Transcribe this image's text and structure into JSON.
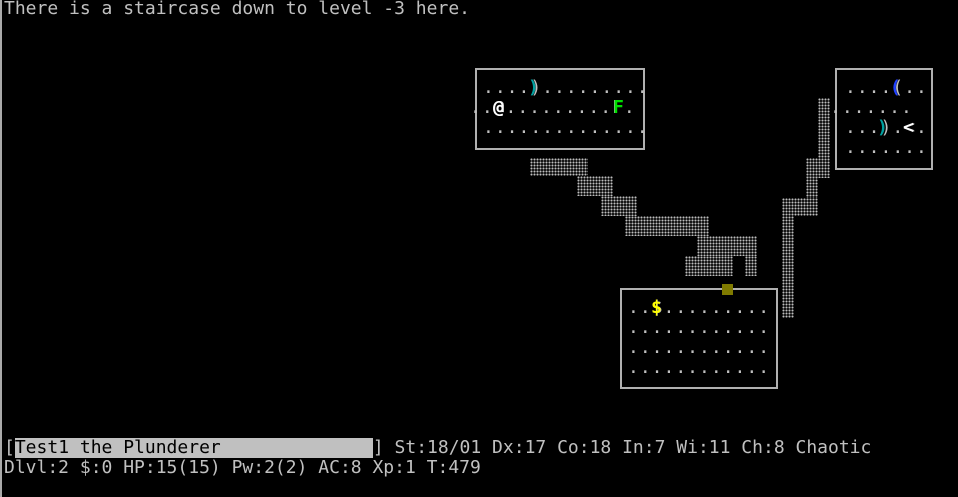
{
  "message": "There is a staircase down to level -3 here.",
  "map": {
    "room1": {
      "row1": "....).........",
      "row2": "..@.........F.",
      "row3": "..............",
      "player": "@",
      "weapon": ")",
      "lichen": "F"
    },
    "room2": {
      "row1": "....(..",
      "row2": ".......",
      "row3": "...).<.",
      "row4": ".......",
      "tool": "(",
      "weapon": ")",
      "upstairs": "<"
    },
    "room3": {
      "row1": "..$.........",
      "row2": "............",
      "row3": "............",
      "row4": "............",
      "gold": "$"
    },
    "colors": {
      "player": "#ffffff",
      "lichen": "#00e000",
      "weapon": "#00a0a0",
      "tool": "#2040ff",
      "gold": "#ffff00",
      "door": "#7f7a00"
    }
  },
  "status": {
    "name_open": "[",
    "name": "Test1 the Plunderer",
    "name_close": "]",
    "line1_rest": " St:18/01 Dx:17 Co:18 In:7 Wi:11 Ch:8 Chaotic",
    "line2": "Dlvl:2 $:0 HP:15(15) Pw:2(2) AC:8 Xp:1 T:479"
  }
}
